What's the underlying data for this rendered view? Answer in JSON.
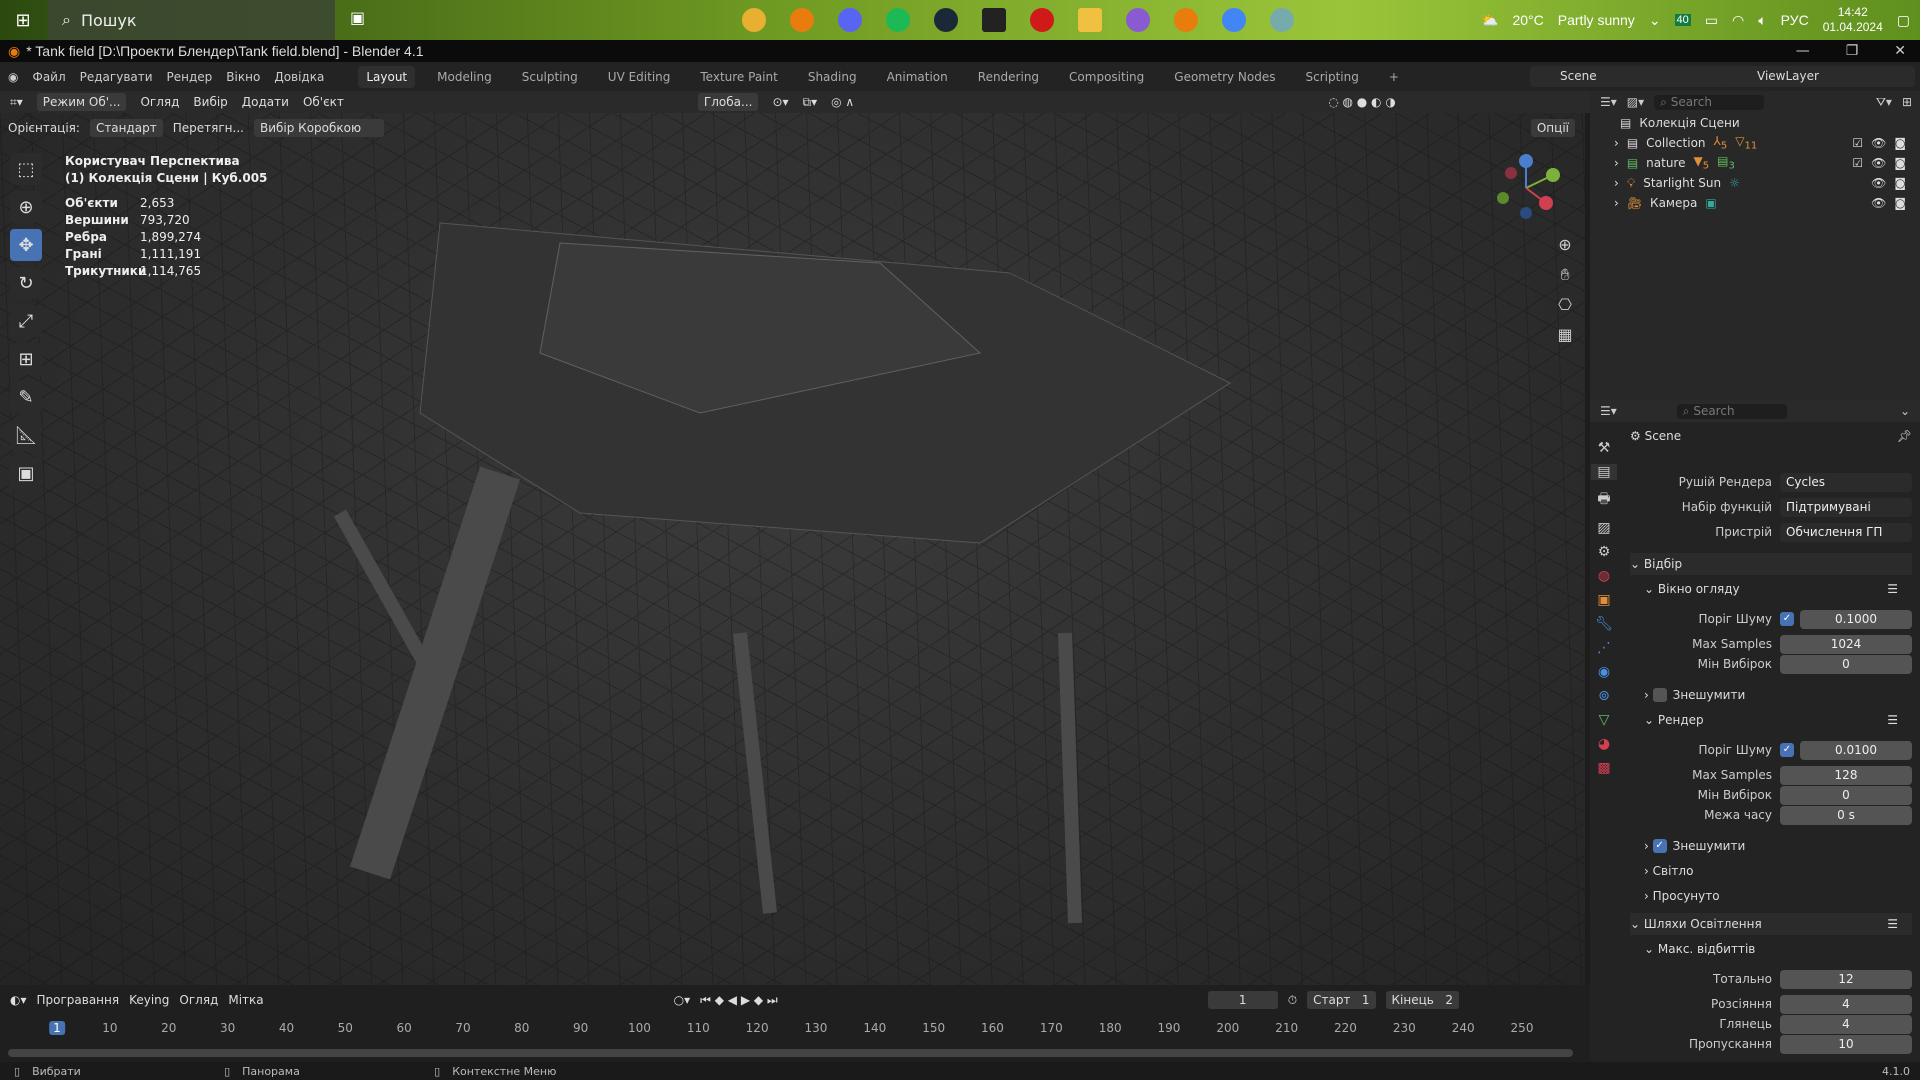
{
  "taskbar": {
    "search": "Пошук",
    "weather": "20°C",
    "weather_text": "Partly sunny",
    "battery_badge": "40",
    "lang": "РУС",
    "time": "14:42",
    "date": "01.04.2024"
  },
  "title": "* Tank field [D:\\Проекти Блендер\\Tank field.blend] - Blender 4.1",
  "menu": [
    "Файл",
    "Редагувати",
    "Рендер",
    "Вікно",
    "Довідка"
  ],
  "workspaces": [
    "Layout",
    "Modeling",
    "Sculpting",
    "UV Editing",
    "Texture Paint",
    "Shading",
    "Animation",
    "Rendering",
    "Compositing",
    "Geometry Nodes",
    "Scripting",
    "+"
  ],
  "scene": "Scene",
  "view_layer": "ViewLayer",
  "header": {
    "mode": "Режим Об'...",
    "items": [
      "Огляд",
      "Вибір",
      "Додати",
      "Об'єкт"
    ],
    "transform": "Глоба..."
  },
  "viewport_header": {
    "orientation_label": "Орієнтація:",
    "orientation": "Стандарт",
    "drag": "Перетягн...",
    "select": "Вибір Коробкою",
    "options": "Опції"
  },
  "overlay": {
    "view": "Користувач Перспектива",
    "collection": "(1) Колекція Сцени | Куб.005",
    "stats": [
      {
        "k": "Об'єкти",
        "v": "2,653"
      },
      {
        "k": "Вершини",
        "v": "793,720"
      },
      {
        "k": "Ребра",
        "v": "1,899,274"
      },
      {
        "k": "Грані",
        "v": "1,111,191"
      },
      {
        "k": "Трикутники",
        "v": "1,114,765"
      }
    ]
  },
  "outliner": {
    "search": "Search",
    "root": "Колекція Сцени",
    "items": [
      {
        "name": "Collection",
        "badge": "5",
        "badge2": "11",
        "color": "#dddddd"
      },
      {
        "name": "nature",
        "badge": "5",
        "badge2": "3",
        "color": "#5fbf5f"
      },
      {
        "name": "Starlight Sun",
        "badge": "",
        "badge2": "",
        "color": "#e0903a"
      },
      {
        "name": "Камера",
        "badge": "",
        "badge2": "",
        "color": "#e0903a"
      }
    ]
  },
  "properties": {
    "search": "Search",
    "context": "Scene",
    "engine_label": "Рушій Рендера",
    "engine": "Cycles",
    "feature_label": "Набір функцій",
    "feature": "Підтримувані",
    "device_label": "Пристрій",
    "device": "Обчислення ГП",
    "sampling": "Відбір",
    "viewport": "Вікно огляду",
    "noise_label": "Поріг Шуму",
    "vp_noise": "0.1000",
    "max_label": "Max Samples",
    "vp_max": "1024",
    "min_label": "Мін Вибірок",
    "vp_min": "0",
    "denoise": "Знешумити",
    "render": "Рендер",
    "r_noise": "0.0100",
    "r_max": "128",
    "r_min": "0",
    "time_label": "Межа часу",
    "r_time": "0 s",
    "lights": "Світло",
    "advanced": "Просунуто",
    "light_paths": "Шляхи Освітлення",
    "max_bounces": "Макс. відбиттів",
    "total_label": "Тотально",
    "total": "12",
    "diffuse_label": "Розсіяння",
    "diffuse": "4",
    "glossy_label": "Глянець",
    "glossy": "4",
    "trans_label": "Пропускання",
    "trans": "10"
  },
  "timeline": {
    "playback": "Програвання",
    "keying": "Keying",
    "view": "Огляд",
    "marker": "Мітка",
    "frame": "1",
    "start_label": "Старт",
    "start": "1",
    "end_label": "Кінець",
    "end": "2",
    "ticks": [
      "1",
      "10",
      "20",
      "30",
      "40",
      "50",
      "60",
      "70",
      "80",
      "90",
      "100",
      "110",
      "120",
      "130",
      "140",
      "150",
      "160",
      "170",
      "180",
      "190",
      "200",
      "210",
      "220",
      "230",
      "240",
      "250"
    ]
  },
  "status": {
    "select": "Вибрати",
    "pan": "Панорама",
    "context": "Контекстне Меню",
    "version": "4.1.0"
  }
}
